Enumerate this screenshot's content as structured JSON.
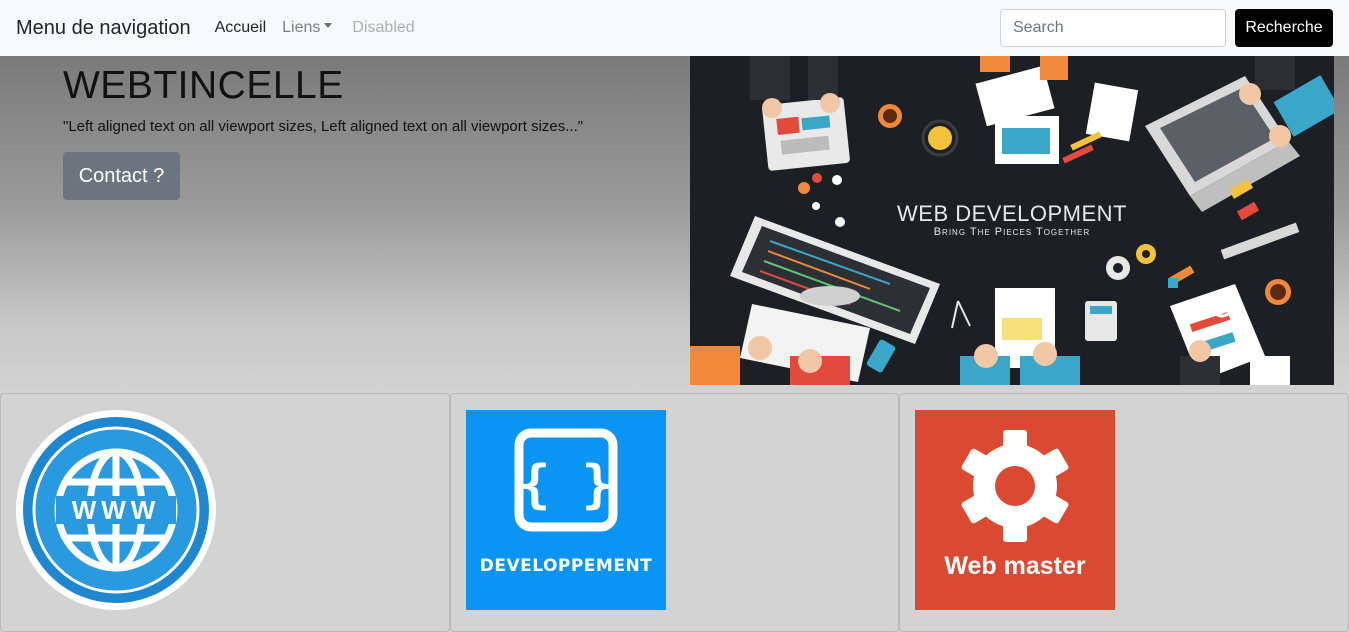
{
  "navbar": {
    "brand": "Menu de navigation",
    "links": {
      "home": "Accueil",
      "links": "Liens",
      "disabled": "Disabled"
    },
    "search": {
      "placeholder": "Search",
      "button": "Recherche"
    }
  },
  "hero": {
    "title": "WEBTINCELLE",
    "text": "\"Left aligned text on all viewport sizes, Left aligned text on all viewport sizes...\"",
    "button": "Contact ?"
  },
  "banner": {
    "title": "WEB DEVELOPMENT",
    "subtitle": "Bring The Pieces Together"
  },
  "cards": [
    {
      "icon": "www-globe-icon",
      "label": "WWW"
    },
    {
      "icon": "code-braces-icon",
      "label": "DEVELOPPEMENT",
      "color": "#0a95f5"
    },
    {
      "icon": "gear-icon",
      "label": "Web master",
      "color": "#da4a33"
    }
  ],
  "colors": {
    "navbar_bg": "#f8f9fa",
    "search_button": "#000000",
    "contact_button": "#6c757d",
    "page_bg": "#d3d3d3"
  }
}
